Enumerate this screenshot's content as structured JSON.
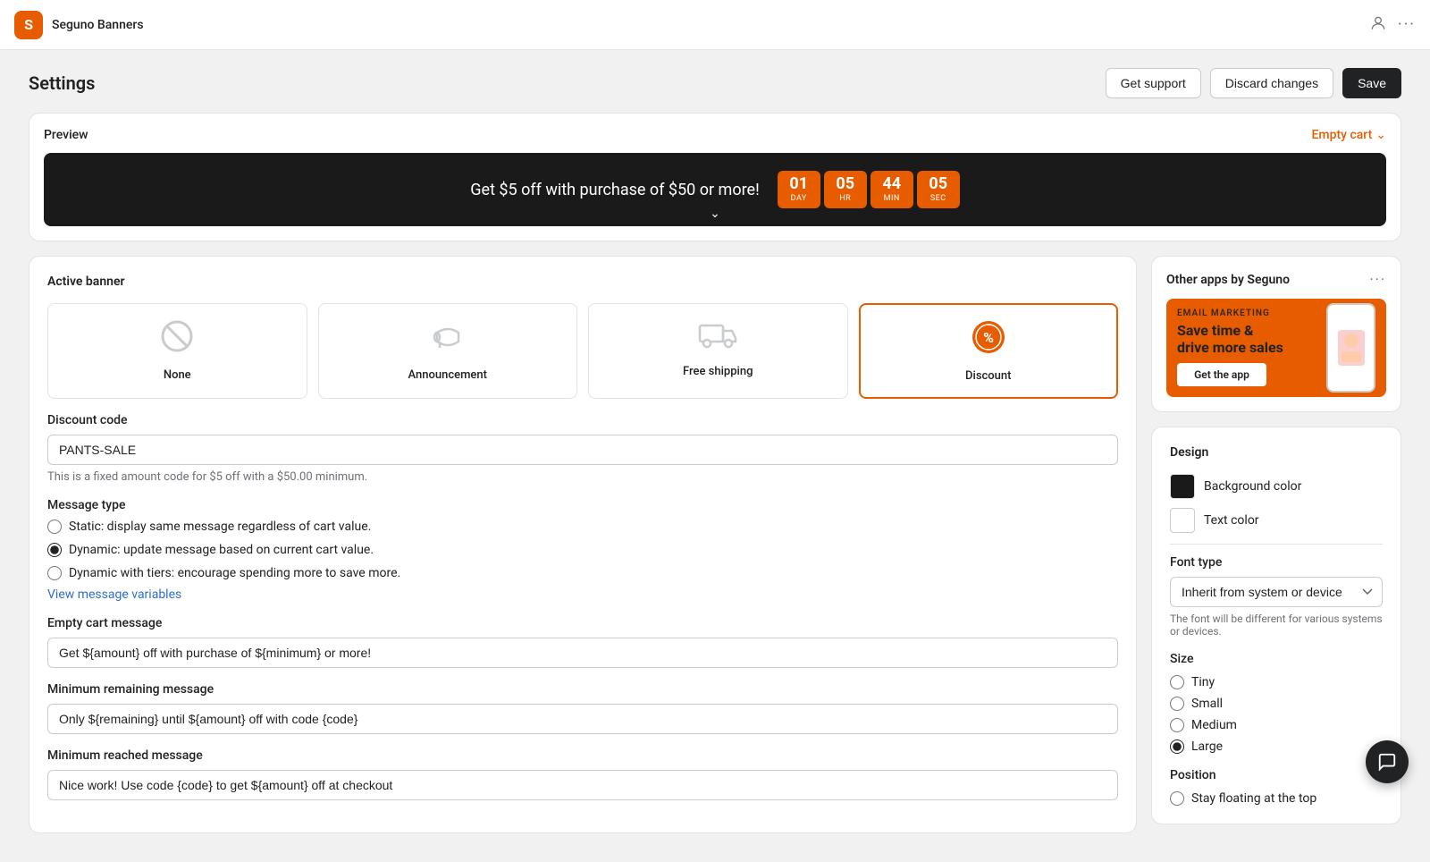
{
  "topbar": {
    "app_name": "Seguno Banners",
    "dots_label": "···"
  },
  "header": {
    "title": "Settings",
    "get_support_label": "Get support",
    "discard_changes_label": "Discard changes",
    "save_label": "Save"
  },
  "preview": {
    "label": "Preview",
    "empty_cart_label": "Empty cart",
    "banner_text": "Get $5 off with purchase of $50 or more!",
    "countdown": [
      {
        "value": "01",
        "unit": "DAY"
      },
      {
        "value": "05",
        "unit": "HR"
      },
      {
        "value": "44",
        "unit": "MIN"
      },
      {
        "value": "05",
        "unit": "SEC"
      }
    ]
  },
  "active_banner": {
    "title": "Active banner",
    "types": [
      {
        "id": "none",
        "label": "None",
        "icon": "none",
        "active": false
      },
      {
        "id": "announcement",
        "label": "Announcement",
        "icon": "announcement",
        "active": false
      },
      {
        "id": "free-shipping",
        "label": "Free shipping",
        "icon": "shipping",
        "active": false
      },
      {
        "id": "discount",
        "label": "Discount",
        "icon": "discount",
        "active": true
      }
    ]
  },
  "discount_code": {
    "label": "Discount code",
    "value": "PANTS-SALE",
    "hint": "This is a fixed amount code for $5 off with a $50.00 minimum."
  },
  "message_type": {
    "label": "Message type",
    "options": [
      {
        "id": "static",
        "label": "Static: display same message regardless of cart value.",
        "checked": false
      },
      {
        "id": "dynamic",
        "label": "Dynamic: update message based on current cart value.",
        "checked": true
      },
      {
        "id": "dynamic-tiers",
        "label": "Dynamic with tiers: encourage spending more to save more.",
        "checked": false
      }
    ],
    "view_variables_link": "View message variables"
  },
  "empty_cart_message": {
    "label": "Empty cart message",
    "value": "Get ${amount} off with purchase of ${minimum} or more!"
  },
  "minimum_remaining_message": {
    "label": "Minimum remaining message",
    "value": "Only ${remaining} until ${amount} off with code {code}"
  },
  "minimum_reached_message": {
    "label": "Minimum reached message",
    "value": "Nice work! Use code {code} to get ${amount} off at checkout"
  },
  "other_apps": {
    "title": "Other apps by Seguno",
    "dots_label": "···",
    "email_tag": "EMAIL MARKETING",
    "email_headline": "Save time &\ndrive more sales",
    "email_btn": "Get the app"
  },
  "design": {
    "title": "Design",
    "background_color_label": "Background color",
    "background_color_value": "#1a1a1a",
    "text_color_label": "Text color",
    "text_color_value": "#ffffff",
    "font_type_label": "Font type",
    "font_type_option": "Inherit from system or device",
    "font_hint": "The font will be different for various systems or devices.",
    "size_label": "Size",
    "size_options": [
      {
        "id": "tiny",
        "label": "Tiny",
        "checked": false
      },
      {
        "id": "small",
        "label": "Small",
        "checked": false
      },
      {
        "id": "medium",
        "label": "Medium",
        "checked": false
      },
      {
        "id": "large",
        "label": "Large",
        "checked": true
      }
    ],
    "position_label": "Position",
    "position_option": "Stay floating at the top"
  }
}
